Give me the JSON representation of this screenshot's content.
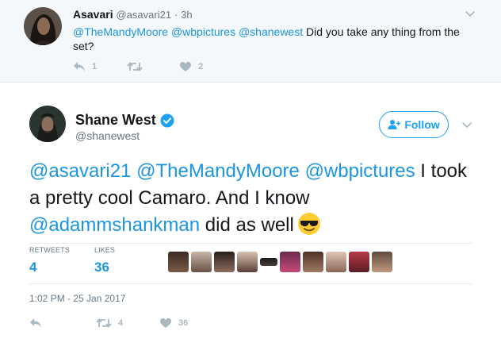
{
  "reply_tweet": {
    "name": "Asavari",
    "handle": "@asavari21",
    "separator": "·",
    "time": "3h",
    "text_parts": [
      "@TheMandyMoore",
      " ",
      "@wbpictures",
      " ",
      "@shanewest",
      " Did you take any thing from the set?"
    ],
    "reply_count": "1",
    "retweet_count": "",
    "like_count": "2"
  },
  "main_tweet": {
    "name": "Shane West",
    "handle": "@shanewest",
    "follow_label": "Follow",
    "text_parts": [
      "@asavari21",
      " ",
      "@TheMandyMoore",
      " ",
      "@wbpictures",
      " I took a pretty cool Camaro. And I know ",
      "@adammshankman",
      " did as well"
    ],
    "retweets_label": "RETWEETS",
    "retweets_value": "4",
    "likes_label": "LIKES",
    "likes_value": "36",
    "timestamp": "1:02 PM - 25 Jan 2017",
    "action_retweet_count": "4",
    "action_like_count": "36"
  },
  "icons": {
    "reply": "reply-icon",
    "retweet": "retweet-icon",
    "like": "heart-icon",
    "caret": "chevron-down-icon",
    "verified": "verified-badge-icon",
    "follow": "add-user-icon",
    "emoji": "sunglasses-emoji"
  },
  "colors": {
    "link": "#1b95e0",
    "follow": "#1da1f2",
    "muted": "#657786",
    "action": "#aab8c2",
    "reply_bg": "#f5f8fa"
  }
}
